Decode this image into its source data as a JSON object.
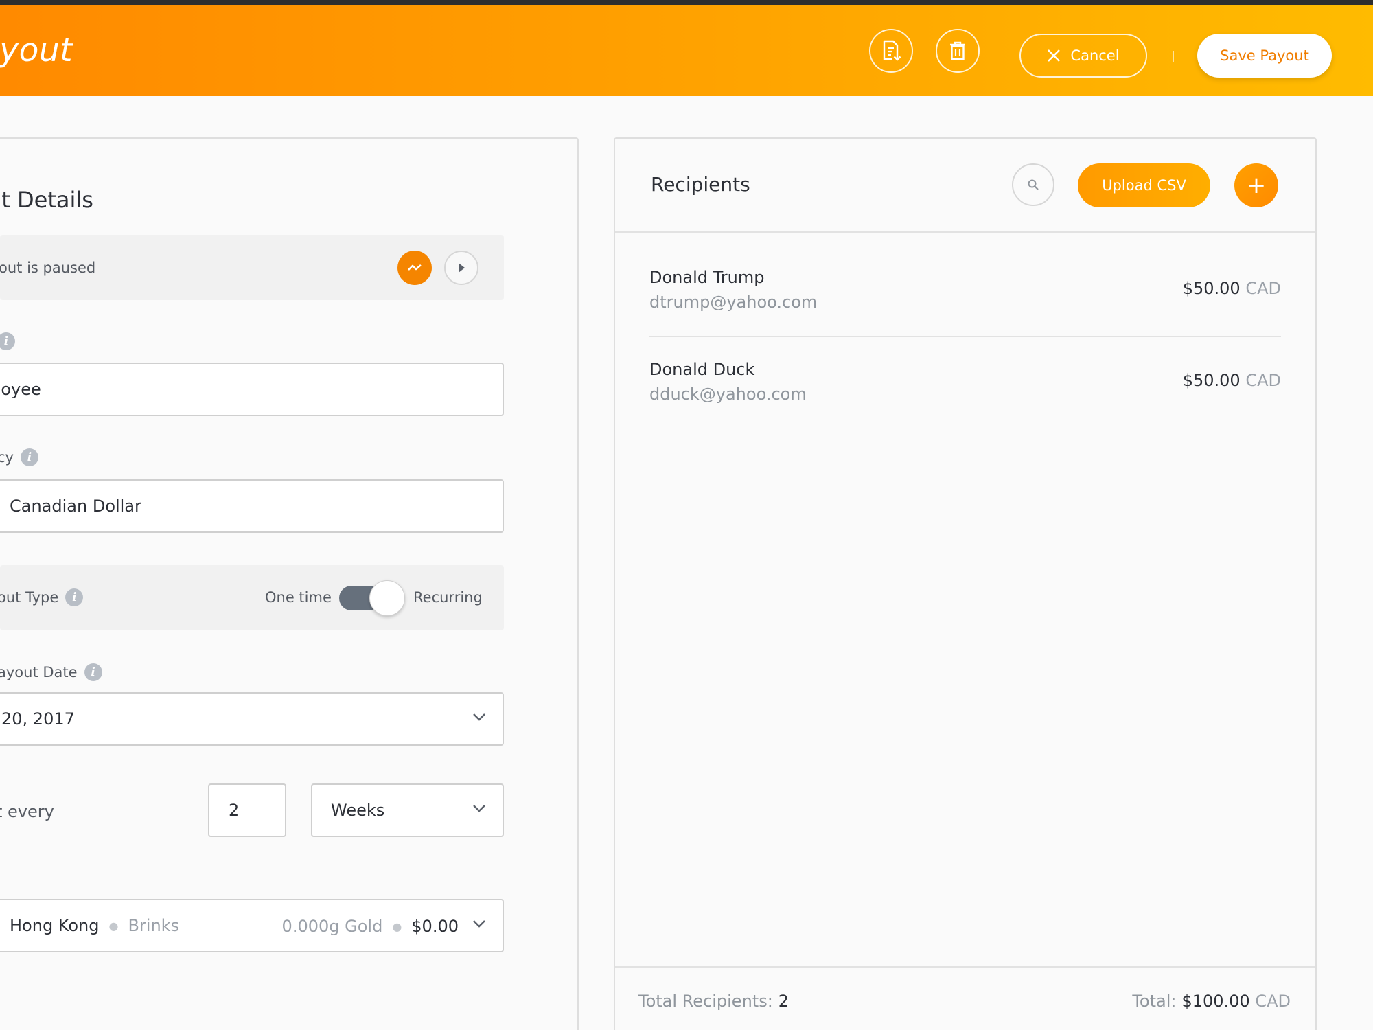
{
  "header": {
    "title": "ayout",
    "export_icon": "export-document-icon",
    "delete_icon": "trash-icon",
    "cancel_label": "Cancel",
    "save_label": "Save Payout"
  },
  "details": {
    "section_title": "ut Details",
    "paused_text": "out is paused",
    "employee_value": "oloyee",
    "currency_label": "cy",
    "currency_value": "Canadian Dollar",
    "type_label": "out Type",
    "type_option_left": "One time",
    "type_option_right": "Recurring",
    "type_recurring_selected": true,
    "date_label": "ayout Date",
    "date_value": "20, 2017",
    "every_label": "t every",
    "every_number": "2",
    "every_unit": "Weeks",
    "vault_location": "Hong Kong",
    "vault_provider": "Brinks",
    "vault_weight": "0.000g Gold",
    "vault_value": "$0.00"
  },
  "recipients": {
    "title": "Recipients",
    "upload_label": "Upload CSV",
    "add_label": "+",
    "items": [
      {
        "name": "Donald Trump",
        "email": "dtrump@yahoo.com",
        "amount": "$50.00",
        "currency": "CAD"
      },
      {
        "name": "Donald Duck",
        "email": "dduck@yahoo.com",
        "amount": "$50.00",
        "currency": "CAD"
      }
    ],
    "footer": {
      "count_label": "Total Recipients:",
      "count_value": "2",
      "total_label": "Total:",
      "total_value": "$100.00",
      "total_currency": "CAD"
    }
  },
  "colors": {
    "accent": "#ff9500",
    "accent_dark": "#f07d00",
    "text": "#2c2f36",
    "muted": "#8f959c"
  }
}
